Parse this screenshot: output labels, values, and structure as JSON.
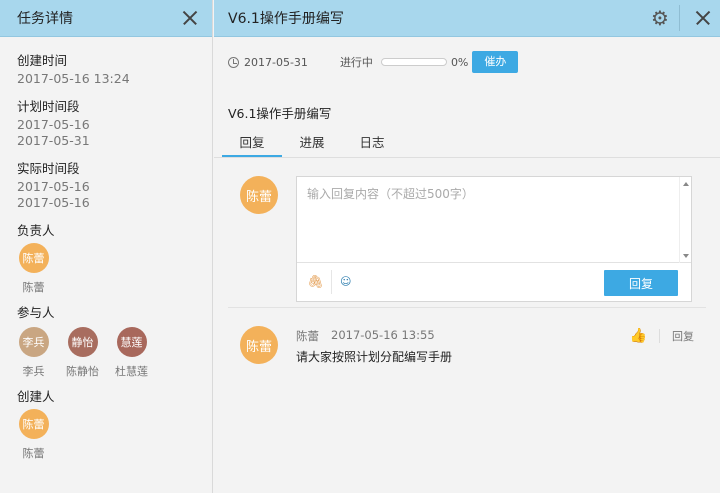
{
  "left": {
    "title": "任务详情",
    "created_label": "创建时间",
    "created_value": "2017-05-16 13:24",
    "plan_label": "计划时间段",
    "plan_start": "2017-05-16",
    "plan_end": "2017-05-31",
    "actual_label": "实际时间段",
    "actual_start": "2017-05-16",
    "actual_end": "2017-05-16",
    "owner_label": "负责人",
    "owner": {
      "avatar": "陈蕾",
      "name": "陈蕾",
      "color": "#f3b15a"
    },
    "participants_label": "参与人",
    "participants": [
      {
        "avatar": "李兵",
        "name": "李兵",
        "color": "#c9a682"
      },
      {
        "avatar": "静怡",
        "name": "陈静怡",
        "color": "#a86d5f"
      },
      {
        "avatar": "慧莲",
        "name": "杜慧莲",
        "color": "#a8685c"
      }
    ],
    "creator_label": "创建人",
    "creator": {
      "avatar": "陈蕾",
      "name": "陈蕾",
      "color": "#f3b15a"
    }
  },
  "right": {
    "title": "V6.1操作手册编写",
    "due_date": "2017-05-31",
    "status": "进行中",
    "progress": 0,
    "progress_text": "0%",
    "urge_label": "催办",
    "task_title": "V6.1操作手册编写",
    "tabs": [
      {
        "label": "回复",
        "active": true
      },
      {
        "label": "进展",
        "active": false
      },
      {
        "label": "日志",
        "active": false
      }
    ],
    "current_user_avatar": "陈蕾",
    "reply_placeholder": "输入回复内容（不超过500字）",
    "reply_button": "回复",
    "comment": {
      "avatar": "陈蕾",
      "author": "陈蕾",
      "time": "2017-05-16 13:55",
      "text": "请大家按照计划分配编写手册",
      "reply_label": "回复"
    }
  },
  "icons": {
    "close": "close-icon",
    "gear": "gear-icon",
    "clock": "clock-icon",
    "attach": "paperclip-icon",
    "emoji": "emoji-icon",
    "thumb": "thumbs-up-icon"
  },
  "colors": {
    "header": "#a8d7ed",
    "accent": "#3da9e3"
  }
}
